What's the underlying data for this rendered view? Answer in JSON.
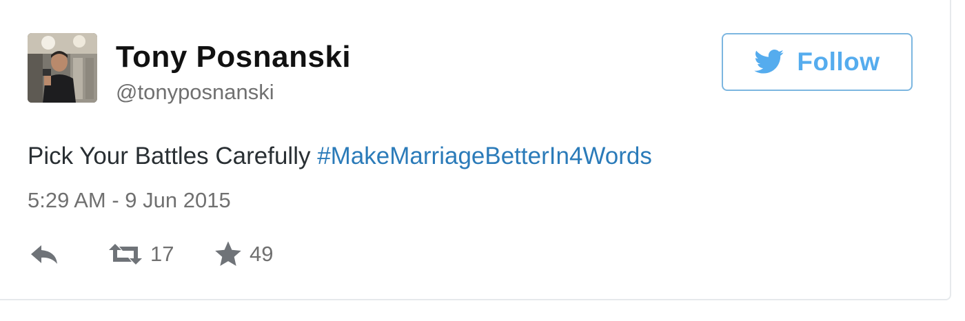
{
  "tweet": {
    "author": {
      "display_name": "Tony Posnanski",
      "handle": "@tonyposnanski",
      "avatar_icon": "profile-photo"
    },
    "follow_button": {
      "label": "Follow",
      "icon": "twitter-bird-icon",
      "accent_color": "#55acee"
    },
    "text": {
      "plain": "Pick Your Battles Carefully ",
      "hashtag": "#MakeMarriageBetterIn4Words",
      "hashtag_color": "#2b7bb9"
    },
    "timestamp": "5:29 AM - 9 Jun 2015",
    "actions": {
      "reply": {
        "icon": "reply-icon"
      },
      "retweet": {
        "icon": "retweet-icon",
        "count": "17"
      },
      "favorite": {
        "icon": "star-icon",
        "count": "49"
      }
    }
  }
}
